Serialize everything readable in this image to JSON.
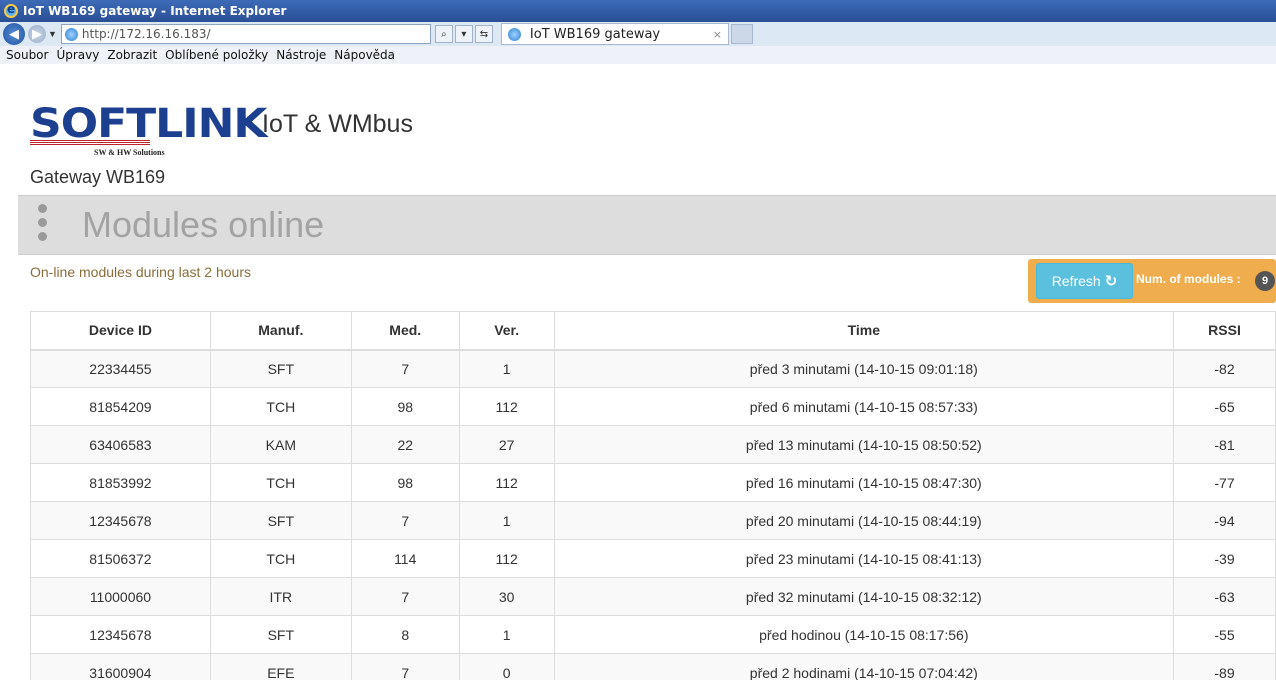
{
  "window": {
    "title": "IoT WB169 gateway - Internet Explorer"
  },
  "browser": {
    "url": "http://172.16.16.183/",
    "tab_title": "IoT WB169 gateway",
    "tab_close": "×",
    "search_icon": "search-icon",
    "menu": [
      "Soubor",
      "Úpravy",
      "Zobrazit",
      "Oblíbené položky",
      "Nástroje",
      "Nápověda"
    ]
  },
  "brand": {
    "logo_text": "SOFTLINK",
    "logo_tagline": "SW & HW Solutions",
    "suffix": "IoT & WMbus",
    "logo_red": "#c0242a",
    "logo_blue": "#1c3f8f"
  },
  "page": {
    "gateway_title": "Gateway WB169",
    "section_title": "Modules online",
    "subtitle": "On-line modules during last 2 hours",
    "refresh_label": "Refresh",
    "count_label": "Num. of modules :",
    "count_value": "9"
  },
  "colors": {
    "warning": "#f0ad4e",
    "info": "#5bc0de",
    "badge": "#555555"
  },
  "table": {
    "headers": [
      "Device ID",
      "Manuf.",
      "Med.",
      "Ver.",
      "Time",
      "RSSI"
    ],
    "rows": [
      [
        "22334455",
        "SFT",
        "7",
        "1",
        "před 3 minutami (14-10-15 09:01:18)",
        "-82"
      ],
      [
        "81854209",
        "TCH",
        "98",
        "112",
        "před 6 minutami (14-10-15 08:57:33)",
        "-65"
      ],
      [
        "63406583",
        "KAM",
        "22",
        "27",
        "před 13 minutami (14-10-15 08:50:52)",
        "-81"
      ],
      [
        "81853992",
        "TCH",
        "98",
        "112",
        "před 16 minutami (14-10-15 08:47:30)",
        "-77"
      ],
      [
        "12345678",
        "SFT",
        "7",
        "1",
        "před 20 minutami (14-10-15 08:44:19)",
        "-94"
      ],
      [
        "81506372",
        "TCH",
        "114",
        "112",
        "před 23 minutami (14-10-15 08:41:13)",
        "-39"
      ],
      [
        "11000060",
        "ITR",
        "7",
        "30",
        "před 32 minutami (14-10-15 08:32:12)",
        "-63"
      ],
      [
        "12345678",
        "SFT",
        "8",
        "1",
        "před hodinou (14-10-15 08:17:56)",
        "-55"
      ],
      [
        "31600904",
        "EFE",
        "7",
        "0",
        "před 2 hodinami (14-10-15 07:04:42)",
        "-89"
      ]
    ]
  }
}
